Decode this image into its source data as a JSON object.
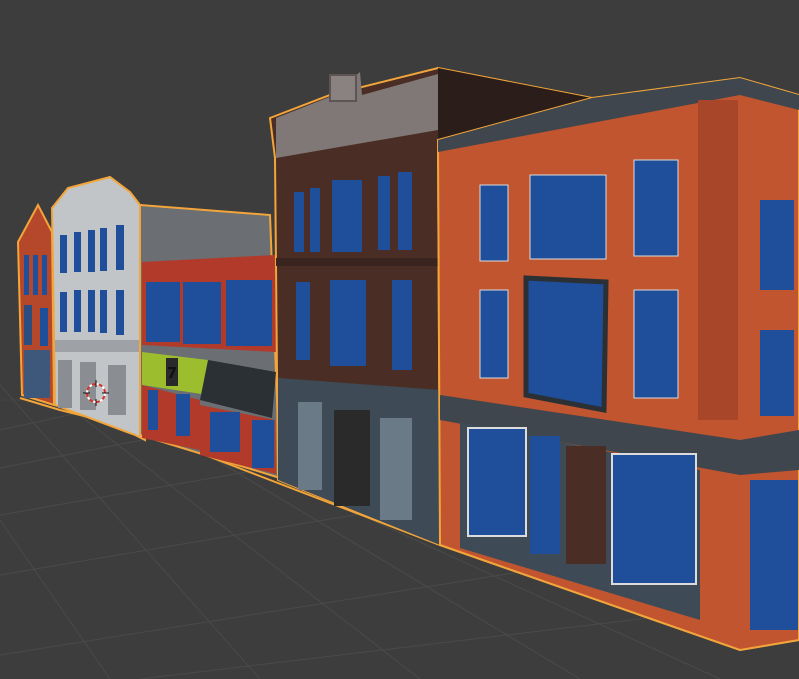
{
  "viewport": {
    "background_color": "#3d3d3d",
    "grid_line_color": "#4a4a4a",
    "selection_outline_color": "#f2a53a"
  },
  "scene": {
    "selected_object": "street-building-row",
    "buildings": [
      {
        "name": "red-gothic-building",
        "wall_color": "#b5472a"
      },
      {
        "name": "grey-stone-building",
        "wall_color": "#bfc2c4"
      },
      {
        "name": "red-storefront-building",
        "wall_color": "#b23a2a",
        "awning_color": "#2b3034"
      },
      {
        "name": "brown-brick-building",
        "wall_color": "#4a2e26"
      },
      {
        "name": "orange-brick-corner-building",
        "wall_color": "#c0552f"
      }
    ],
    "window_color": "#1f4e9a",
    "shop_sign_text": "7",
    "shop_sign_color": "#9cbe2e",
    "icons": [
      "3d-cursor-icon"
    ]
  }
}
